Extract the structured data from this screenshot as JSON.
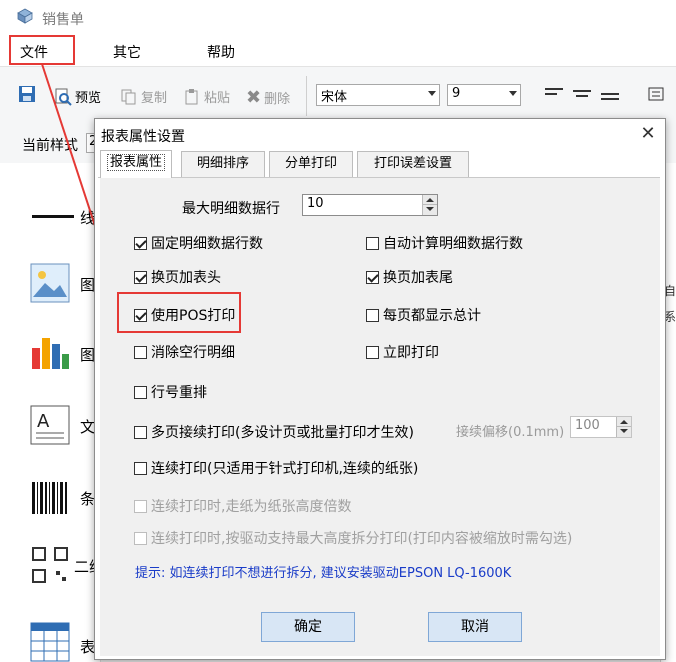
{
  "window": {
    "title": "销售单"
  },
  "menu": {
    "items": [
      "文件",
      "其它",
      "帮助"
    ]
  },
  "toolbar": {
    "preview": "预览",
    "copy": "复制",
    "paste": "粘贴",
    "delete": "删除",
    "font": "宋体",
    "size": "9"
  },
  "row2": {
    "style_label": "当前样式",
    "style_value": "2"
  },
  "left_panel": {
    "items": [
      "线",
      "图",
      "图",
      "文",
      "条",
      "二维",
      "表"
    ]
  },
  "right_panel": {
    "cells": [
      "自",
      "系"
    ]
  },
  "dialog": {
    "title": "报表属性设置",
    "close": "✕",
    "tabs": [
      "报表属性",
      "明细排序",
      "分单打印",
      "打印误差设置"
    ],
    "max_rows_label": "最大明细数据行",
    "max_rows_value": "10",
    "options": {
      "fixed_rows": "固定明细数据行数",
      "auto_calc": "自动计算明细数据行数",
      "page_header": "换页加表头",
      "page_footer": "换页加表尾",
      "use_pos": "使用POS打印",
      "show_total": "每页都显示总计",
      "remove_empty": "消除空行明细",
      "print_now": "立即打印",
      "renumber": "行号重排",
      "multi_page": "多页接续打印(多设计页或批量打印才生效)",
      "offset_label": "接续偏移(0.1mm)",
      "offset_value": "100",
      "continuous": "连续打印(只适用于针式打印机,连续的纸张)",
      "paper_multiple": "连续打印时,走纸为纸张高度倍数",
      "driver_split": "连续打印时,按驱动支持最大高度拆分打印(打印内容被缩放时需勾选)"
    },
    "hint": "提示: 如连续打印不想进行拆分, 建议安装驱动EPSON LQ-1600K",
    "ok": "确定",
    "cancel": "取消"
  },
  "colors": {
    "highlight": "#e53935",
    "hint": "#1a3cc8",
    "button_bg": "#d8e6f5"
  }
}
